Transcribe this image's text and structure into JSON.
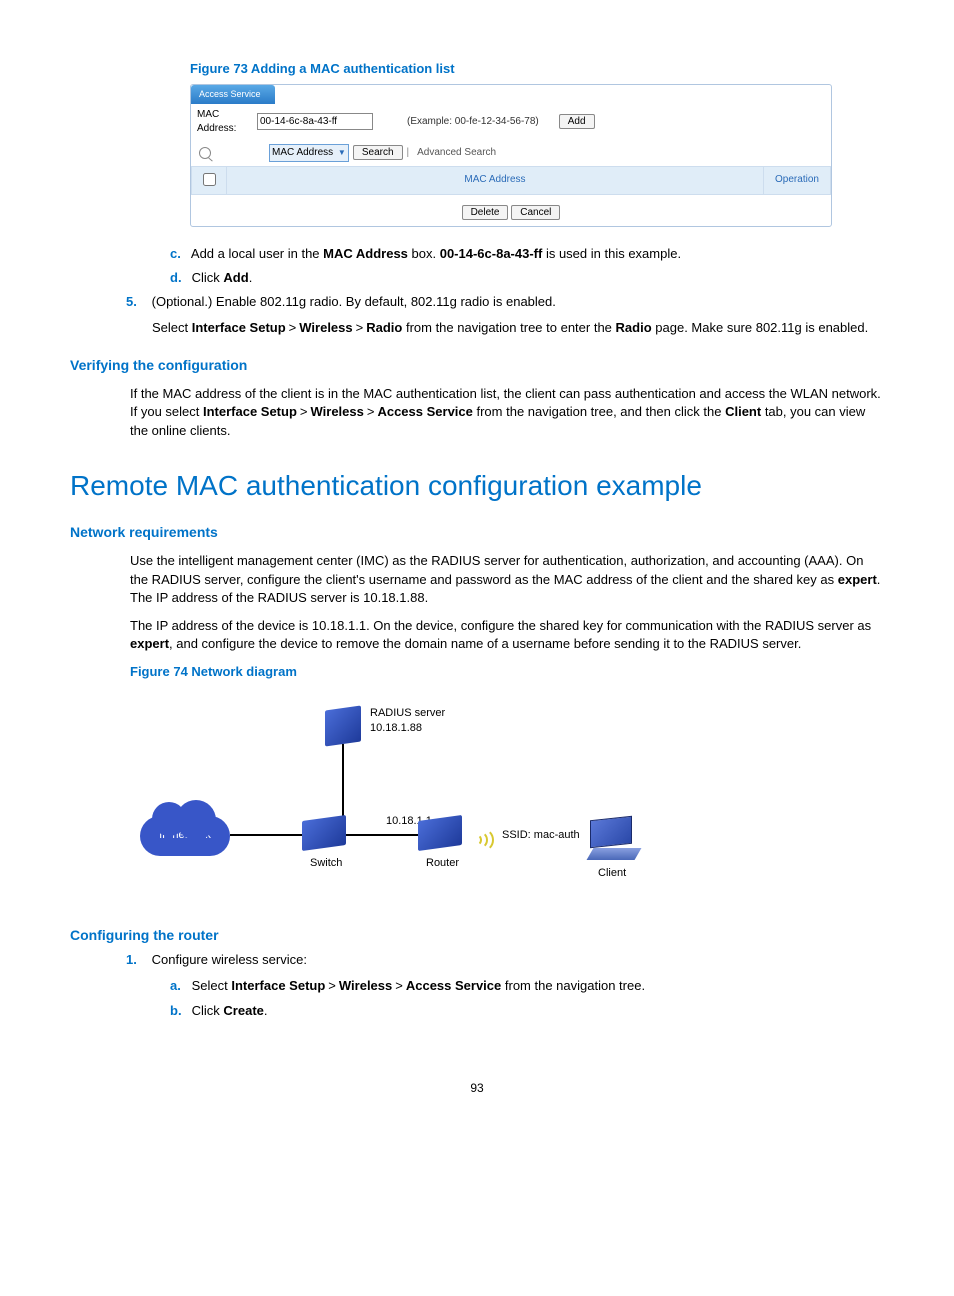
{
  "figure73": {
    "title": "Figure 73 Adding a MAC authentication list",
    "panel_header": "Access Service",
    "mac_label": "MAC Address:",
    "mac_value": "00-14-6c-8a-43-ff",
    "example": "(Example: 00-fe-12-34-56-78)",
    "add_btn": "Add",
    "search_field": "MAC Address",
    "search_btn": "Search",
    "adv_search": "Advanced Search",
    "col_mac": "MAC Address",
    "col_op": "Operation",
    "delete_btn": "Delete",
    "cancel_btn": "Cancel"
  },
  "steps_cd": {
    "c_pre": "Add a local user in the ",
    "c_b1": "MAC Address",
    "c_mid": " box. ",
    "c_b2": "00-14-6c-8a-43-ff",
    "c_post": " is used in this example.",
    "d_pre": "Click ",
    "d_b": "Add",
    "d_post": "."
  },
  "step5": {
    "line1": "(Optional.) Enable 802.11g radio. By default, 802.11g radio is enabled.",
    "l2_pre": "Select ",
    "l2_b1": "Interface Setup",
    "l2_b2": "Wireless",
    "l2_b3": "Radio",
    "l2_mid": " from the navigation tree to enter the ",
    "l2_b4": "Radio",
    "l2_post": " page. Make sure 802.11g is enabled."
  },
  "verify": {
    "heading": "Verifying the configuration",
    "p_pre": "If the MAC address of the client is in the MAC authentication list, the client can pass authentication and access the WLAN network. If you select ",
    "b1": "Interface Setup",
    "b2": "Wireless",
    "b3": "Access Service",
    "p_mid": " from the navigation tree, and then click the ",
    "b4": "Client",
    "p_post": " tab, you can view the online clients."
  },
  "h1": "Remote MAC authentication configuration example",
  "netreq": {
    "heading": "Network requirements",
    "p1_pre": "Use the intelligent management center (IMC) as the RADIUS server for authentication, authorization, and accounting (AAA). On the RADIUS server, configure the client's username and password as the MAC address of the client and the shared key as ",
    "p1_b": "expert",
    "p1_post": ". The IP address of the RADIUS server is 10.18.1.88.",
    "p2_pre": "The IP address of the device is 10.18.1.1. On the device, configure the shared key for communication with the RADIUS server as ",
    "p2_b": "expert",
    "p2_post": ", and configure the device to remove the domain name of a username before sending it to the RADIUS server."
  },
  "figure74": {
    "title": "Figure 74 Network diagram",
    "radius_label": "RADIUS server",
    "radius_ip": "10.18.1.88",
    "router_ip": "10.18.1.1",
    "ipnet": "IP network",
    "switch": "Switch",
    "router": "Router",
    "ssid": "SSID: mac-auth",
    "client": "Client"
  },
  "confrouter": {
    "heading": "Configuring the router",
    "s1": "Configure wireless service:",
    "a_pre": "Select ",
    "a_b1": "Interface Setup",
    "a_b2": "Wireless",
    "a_b3": "Access Service",
    "a_post": " from the navigation tree.",
    "b_pre": "Click ",
    "b_b": "Create",
    "b_post": "."
  },
  "page": "93"
}
